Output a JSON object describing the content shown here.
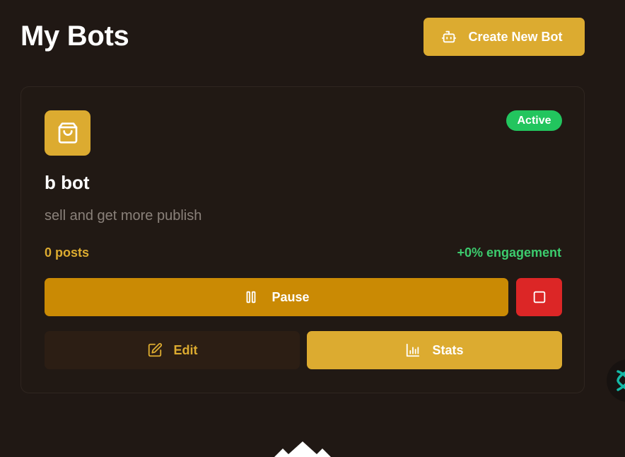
{
  "header": {
    "title": "My Bots",
    "create_button_label": "Create New Bot",
    "create_button_icon": "bot-icon"
  },
  "bot": {
    "icon": "shopping-bag-icon",
    "status": "Active",
    "name": "b bot",
    "description": "sell and get more publish",
    "posts": "0 posts",
    "engagement": "+0% engagement"
  },
  "actions": {
    "pause_label": "Pause",
    "pause_icon": "pause-icon",
    "stop_icon": "stop-icon",
    "edit_label": "Edit",
    "edit_icon": "edit-icon",
    "stats_label": "Stats",
    "stats_icon": "bar-chart-icon"
  },
  "colors": {
    "background": "#201814",
    "accent": "#dcab30",
    "pause": "#ca8a04",
    "stop": "#dc2626",
    "active_badge": "#22c55e",
    "engagement_text": "#3ccc6e"
  }
}
